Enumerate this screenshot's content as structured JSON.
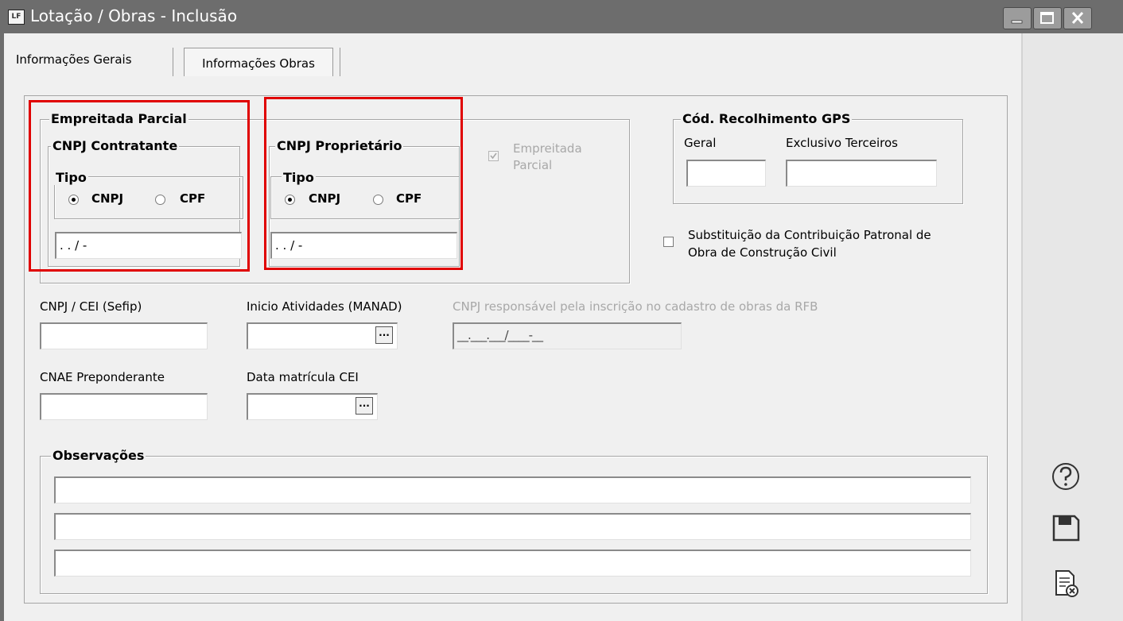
{
  "window": {
    "title": "Lotação / Obras - Inclusão",
    "app_icon": "LF"
  },
  "tabs": [
    {
      "label": "Informações Gerais",
      "active": false
    },
    {
      "label": "Informações Obras",
      "active": true
    }
  ],
  "empreitada_parcial": {
    "legend": "Empreitada Parcial",
    "cnpj_contratante": {
      "legend": "CNPJ Contratante",
      "tipo_legend": "Tipo",
      "option_cnpj": "CNPJ",
      "option_cpf": "CPF",
      "selected": "CNPJ",
      "mask": " .  .  /  -"
    },
    "cnpj_proprietario": {
      "legend": "CNPJ Proprietário",
      "tipo_legend": "Tipo",
      "option_cnpj": "CNPJ",
      "option_cpf": "CPF",
      "selected": "CNPJ",
      "mask": " .  .  /  -"
    },
    "checkbox_label_line1": "Empreitada",
    "checkbox_label_line2": "Parcial",
    "checkbox_checked": true
  },
  "cod_recolhimento": {
    "legend": "Cód. Recolhimento GPS",
    "geral_label": "Geral",
    "exclusivo_label": "Exclusivo Terceiros",
    "geral_value": "",
    "exclusivo_value": ""
  },
  "substituicao": {
    "label_line1": "Substituição da Contribuição Patronal de",
    "label_line2": "Obra de Construção Civil",
    "checked": false
  },
  "fields": {
    "cnpj_cei_label": "CNPJ / CEI (Sefip)",
    "cnpj_cei_value": "",
    "inicio_atividades_label": "Inicio Atividades (MANAD)",
    "inicio_atividades_value": "",
    "cnpj_responsavel_label": "CNPJ responsável pela inscrição no cadastro de obras da RFB",
    "cnpj_responsavel_mask": "__.___.___/____-__",
    "cnae_label": "CNAE Preponderante",
    "cnae_value": "",
    "data_matricula_label": "Data matrícula CEI",
    "data_matricula_value": "",
    "dots_label": "..."
  },
  "observacoes": {
    "legend": "Observações",
    "lines": [
      "",
      "",
      ""
    ]
  },
  "side_actions": [
    {
      "icon": "help-icon"
    },
    {
      "icon": "save-icon"
    },
    {
      "icon": "cancel-document-icon"
    }
  ],
  "colors": {
    "titlebar": "#6d6d6d",
    "highlight": "#e00000"
  }
}
